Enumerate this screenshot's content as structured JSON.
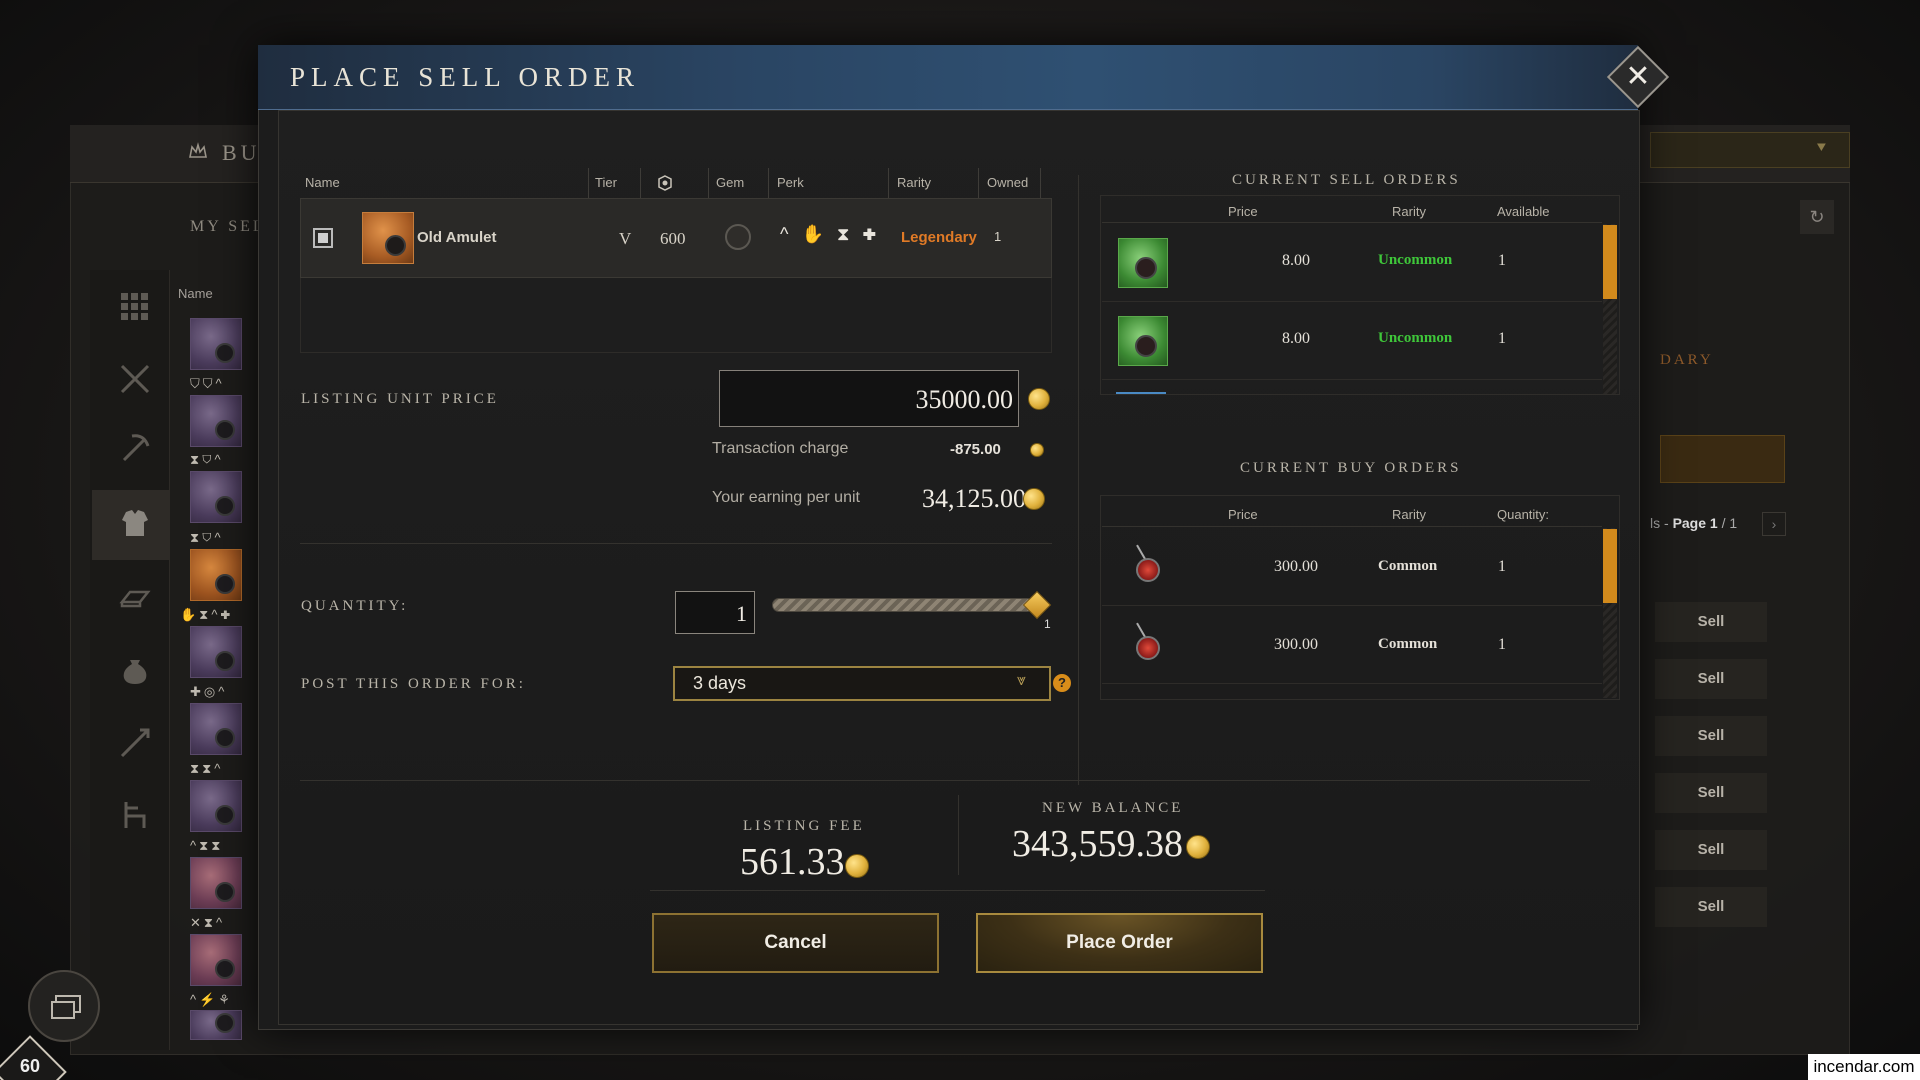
{
  "background": {
    "buy_label": "BUY",
    "my_sell_label": "MY SEL",
    "name_column": "Name",
    "legendary_fragment": "DARY",
    "page_label": "ls - ",
    "page_text": "Page 1",
    "page_total": "/ 1",
    "sell_buttons": [
      "Sell",
      "Sell",
      "Sell",
      "Sell",
      "Sell",
      "Sell"
    ],
    "level": "60"
  },
  "watermark": "incendar.com",
  "modal": {
    "title": "PLACE SELL ORDER",
    "close_icon": "close-icon",
    "item_table": {
      "headers": {
        "name": "Name",
        "tier": "Tier",
        "gear_score_icon": "gear-score-icon",
        "gem": "Gem",
        "perk": "Perk",
        "rarity": "Rarity",
        "owned": "Owned"
      },
      "item": {
        "name": "Old Amulet",
        "tier": "V",
        "gear_score": "600",
        "rarity": "Legendary",
        "owned": "1",
        "perks": "^ ✋ ⧗ ✚"
      }
    },
    "listing_unit_price_label": "LISTING UNIT PRICE",
    "listing_unit_price": "35000.00",
    "transaction_charge_label": "Transaction charge",
    "transaction_charge": "-875.00",
    "earning_label": "Your earning per unit",
    "earning_value": "34,125.00",
    "quantity_label": "QUANTITY:",
    "quantity_value": "1",
    "quantity_max": "1",
    "quantity_fraction": 1.0,
    "post_label": "POST THIS ORDER FOR:",
    "post_value": "3 days",
    "help_icon": "?",
    "sell_orders": {
      "title": "CURRENT SELL ORDERS",
      "headers": {
        "price": "Price",
        "rarity": "Rarity",
        "available": "Available"
      },
      "rows": [
        {
          "price": "8.00",
          "rarity": "Uncommon",
          "available": "1"
        },
        {
          "price": "8.00",
          "rarity": "Uncommon",
          "available": "1"
        }
      ]
    },
    "buy_orders": {
      "title": "CURRENT BUY ORDERS",
      "headers": {
        "price": "Price",
        "rarity": "Rarity",
        "quantity": "Quantity:"
      },
      "rows": [
        {
          "price": "300.00",
          "rarity": "Common",
          "quantity": "1"
        },
        {
          "price": "300.00",
          "rarity": "Common",
          "quantity": "1"
        }
      ]
    },
    "listing_fee_label": "LISTING FEE",
    "listing_fee": "561.33",
    "new_balance_label": "NEW BALANCE",
    "new_balance": "343,559.38",
    "cancel_label": "Cancel",
    "place_order_label": "Place Order"
  },
  "colors": {
    "legendary": "#e07a26",
    "uncommon": "#3fc73a",
    "gold_border": "#9c8441",
    "title_bar": "#2a4563"
  }
}
